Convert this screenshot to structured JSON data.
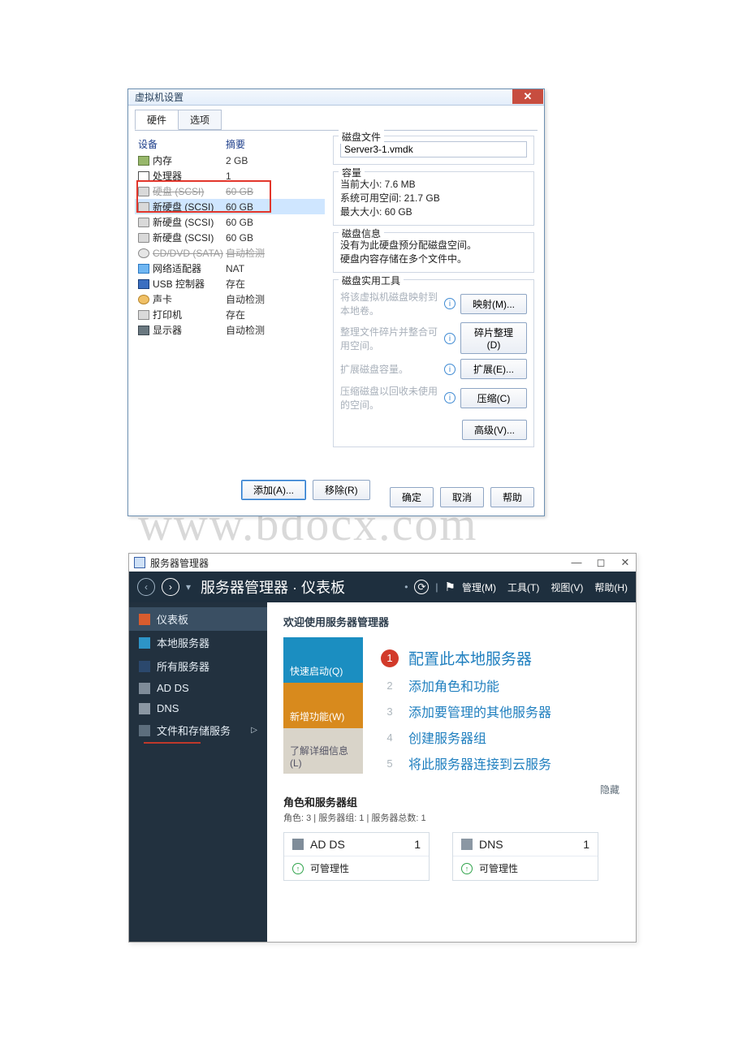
{
  "watermark": "www.bdocx.com",
  "vmdlg": {
    "title": "虚拟机设置",
    "tabs": [
      "硬件",
      "选项"
    ],
    "active_tab": 0,
    "headers": {
      "device": "设备",
      "summary": "摘要"
    },
    "devices": [
      {
        "icon": "mem",
        "name": "内存",
        "summary": "2 GB"
      },
      {
        "icon": "cpu",
        "name": "处理器",
        "summary": "1"
      },
      {
        "icon": "disk",
        "name": "硬盘 (SCSI)",
        "summary": "60 GB",
        "strike": true
      },
      {
        "icon": "disk",
        "name": "新硬盘 (SCSI)",
        "summary": "60 GB",
        "sel": true
      },
      {
        "icon": "disk",
        "name": "新硬盘 (SCSI)",
        "summary": "60 GB"
      },
      {
        "icon": "disk",
        "name": "新硬盘 (SCSI)",
        "summary": "60 GB"
      },
      {
        "icon": "cd",
        "name": "CD/DVD (SATA)",
        "summary": "自动检测",
        "strike": true
      },
      {
        "icon": "net",
        "name": "网络适配器",
        "summary": "NAT"
      },
      {
        "icon": "usb",
        "name": "USB 控制器",
        "summary": "存在"
      },
      {
        "icon": "snd",
        "name": "声卡",
        "summary": "自动检测"
      },
      {
        "icon": "prn",
        "name": "打印机",
        "summary": "存在"
      },
      {
        "icon": "disp",
        "name": "显示器",
        "summary": "自动检测"
      }
    ],
    "buttons": {
      "add": "添加(A)...",
      "remove": "移除(R)"
    },
    "diskfile": {
      "legend": "磁盘文件",
      "value": "Server3-1.vmdk"
    },
    "capacity": {
      "legend": "容量",
      "current": "当前大小: 7.6 MB",
      "free": "系统可用空间: 21.7 GB",
      "max": "最大大小: 60 GB"
    },
    "diskinfo": {
      "legend": "磁盘信息",
      "l1": "没有为此硬盘预分配磁盘空间。",
      "l2": "硬盘内容存储在多个文件中。"
    },
    "tools": {
      "legend": "磁盘实用工具",
      "map_desc": "将该虚拟机磁盘映射到本地卷。",
      "map_btn": "映射(M)...",
      "defrag_desc": "整理文件碎片并整合可用空间。",
      "defrag_btn": "碎片整理(D)",
      "expand_desc": "扩展磁盘容量。",
      "expand_btn": "扩展(E)...",
      "compact_desc": "压缩磁盘以回收未使用的空间。",
      "compact_btn": "压缩(C)",
      "advanced": "高级(V)..."
    },
    "bottom": {
      "ok": "确定",
      "cancel": "取消",
      "help": "帮助"
    }
  },
  "srv": {
    "title": "服务器管理器",
    "breadcrumb": "服务器管理器 · 仪表板",
    "menus": [
      "管理(M)",
      "工具(T)",
      "视图(V)",
      "帮助(H)"
    ],
    "nav": [
      {
        "icon": "grid",
        "label": "仪表板",
        "sel": true
      },
      {
        "icon": "srv",
        "label": "本地服务器"
      },
      {
        "icon": "all",
        "label": "所有服务器"
      },
      {
        "icon": "ad",
        "label": "AD DS"
      },
      {
        "icon": "dns",
        "label": "DNS"
      },
      {
        "icon": "file",
        "label": "文件和存储服务",
        "expand": true
      }
    ],
    "welcome": "欢迎使用服务器管理器",
    "tiles": [
      {
        "cls": "blue",
        "label": "快速启动(Q)"
      },
      {
        "cls": "orange",
        "label": "新增功能(W)"
      },
      {
        "cls": "gray",
        "label": "了解详细信息(L)"
      }
    ],
    "quick": [
      {
        "n": "1",
        "cls": "red",
        "label": "配置此本地服务器",
        "big": true
      },
      {
        "n": "2",
        "cls": "g",
        "label": "添加角色和功能"
      },
      {
        "n": "3",
        "cls": "g",
        "label": "添加要管理的其他服务器"
      },
      {
        "n": "4",
        "cls": "g",
        "label": "创建服务器组"
      },
      {
        "n": "5",
        "cls": "g",
        "label": "将此服务器连接到云服务"
      }
    ],
    "hide": "隐藏",
    "roles": {
      "title": "角色和服务器组",
      "sub": "角色: 3 | 服务器组: 1 | 服务器总数: 1"
    },
    "cards": [
      {
        "icon": "ad",
        "name": "AD DS",
        "count": "1",
        "row": "可管理性"
      },
      {
        "icon": "dns",
        "name": "DNS",
        "count": "1",
        "row": "可管理性"
      }
    ]
  }
}
